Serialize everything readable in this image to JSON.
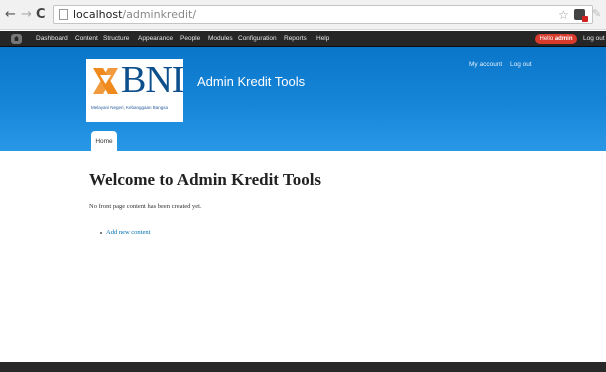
{
  "browser": {
    "url_host": "localhost",
    "url_path": "/adminkredit/"
  },
  "toolbar": {
    "items": [
      "Dashboard",
      "Content",
      "Structure",
      "Appearance",
      "People",
      "Modules",
      "Configuration",
      "Reports",
      "Help"
    ],
    "hello_prefix": "Hello",
    "hello_user": "admin",
    "logout": "Log out"
  },
  "header": {
    "logo_text": "BNI",
    "logo_tagline": "Melayani Negeri, Kebanggaan Bangsa",
    "site_name": "Admin Kredit Tools",
    "secondary_menu": [
      "My account",
      "Log out"
    ],
    "tabs": [
      "Home"
    ]
  },
  "main": {
    "title": "Welcome to Admin Kredit Tools",
    "intro": "No front page content has been created yet.",
    "links": [
      "Add new content"
    ]
  },
  "colors": {
    "header_blue": "#1685d8",
    "toolbar_dark": "#262626",
    "hello_red": "#d83a2c",
    "logo_blue": "#0d4f8c",
    "logo_orange": "#f08a1c",
    "link_blue": "#0071b3"
  },
  "icons": [
    "back-arrow-icon",
    "forward-arrow-icon",
    "reload-icon",
    "page-icon",
    "star-icon",
    "extension-icon",
    "home-icon"
  ]
}
